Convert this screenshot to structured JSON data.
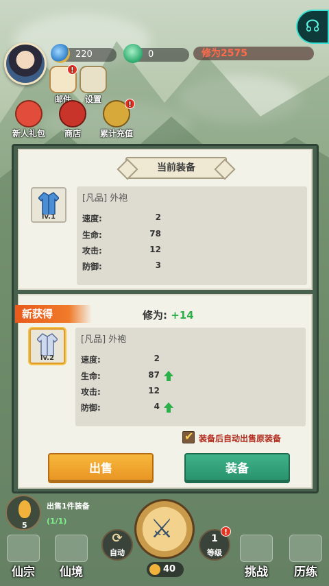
{
  "hud": {
    "spirit_stone": "220",
    "jade": "0",
    "cultivation": "修为2575",
    "menu": [
      {
        "label": "邮件",
        "badge": "!"
      },
      {
        "label": "设置",
        "badge": ""
      },
      {
        "label": "新人礼包",
        "badge": ""
      },
      {
        "label": "商店",
        "badge": ""
      },
      {
        "label": "累计充值",
        "badge": "!"
      }
    ],
    "chat_icon": "chat-icon"
  },
  "current": {
    "title": "当前装备",
    "item_name": "[凡品] 外袍",
    "level": "lv.1",
    "stats": [
      {
        "label": "速度:",
        "value": "2",
        "up": false
      },
      {
        "label": "生命:",
        "value": "78",
        "up": false
      },
      {
        "label": "攻击:",
        "value": "12",
        "up": false
      },
      {
        "label": "防御:",
        "value": "3",
        "up": false
      }
    ]
  },
  "new_item": {
    "ribbon": "新获得",
    "cultivation_label": "修为:",
    "cultivation_gain": "+14",
    "item_name": "[凡品] 外袍",
    "level": "lv.2",
    "stats": [
      {
        "label": "速度:",
        "value": "2",
        "up": false
      },
      {
        "label": "生命:",
        "value": "87",
        "up": true
      },
      {
        "label": "攻击:",
        "value": "12",
        "up": false
      },
      {
        "label": "防御:",
        "value": "4",
        "up": true
      }
    ],
    "auto_sell_label": "装备后自动出售原装备",
    "auto_sell_checked": true,
    "sell_button": "出售",
    "equip_button": "装备"
  },
  "bottom": {
    "sell_info": "出售1件装备",
    "sell_count": "(1/1)",
    "gourd_count": "5",
    "gold": "40",
    "auto_label": "自动",
    "level_label": "等级",
    "level_value": "1",
    "level_badge": "!",
    "nav": [
      "仙宗",
      "仙境",
      "挑战",
      "历练"
    ]
  }
}
